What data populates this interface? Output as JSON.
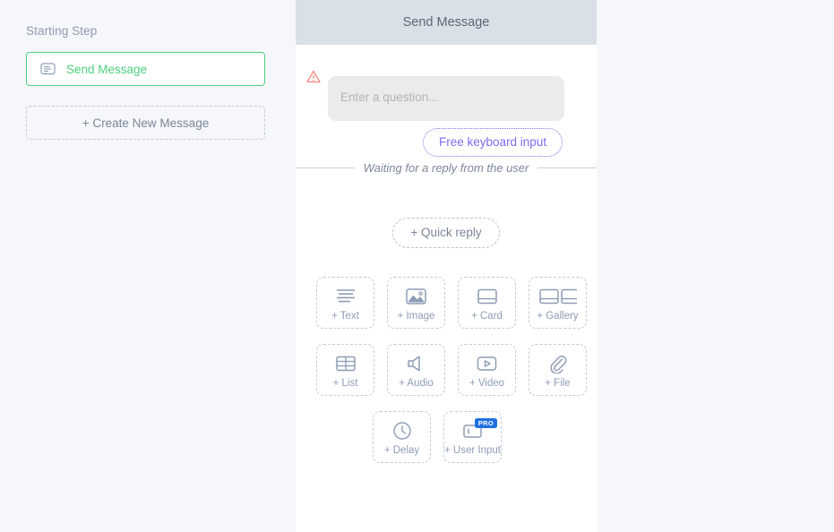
{
  "sidebar": {
    "section_label": "Starting Step",
    "steps": [
      {
        "label": "Send Message",
        "icon": "speech-bubble-icon",
        "color": "#4ed07e"
      }
    ],
    "create_button_label": "+ Create New Message"
  },
  "panel": {
    "title": "Send Message",
    "warning_icon": "warning-triangle-icon",
    "message": {
      "placeholder": "Enter a question...",
      "value": ""
    },
    "free_keyboard_input_label": "Free keyboard input",
    "waiting_text": "Waiting for a reply from the user",
    "quick_reply_label": "+ Quick reply",
    "tiles": [
      {
        "label": "+ Text",
        "icon": "text-lines-icon"
      },
      {
        "label": "+ Image",
        "icon": "image-icon"
      },
      {
        "label": "+ Card",
        "icon": "card-icon"
      },
      {
        "label": "+ Gallery",
        "icon": "gallery-icon"
      },
      {
        "label": "+ List",
        "icon": "list-table-icon"
      },
      {
        "label": "+ Audio",
        "icon": "speaker-icon"
      },
      {
        "label": "+ Video",
        "icon": "video-play-icon"
      },
      {
        "label": "+ File",
        "icon": "paperclip-icon"
      },
      {
        "label": "+ Delay",
        "icon": "clock-icon"
      },
      {
        "label": "+ User Input",
        "icon": "user-input-icon",
        "badge": "PRO"
      }
    ]
  },
  "colors": {
    "page_background": "#f5f7fa",
    "panel_header": "#d9e0e8",
    "accent_green": "#4ed07e",
    "accent_purple": "#7c6cf0",
    "warning_red": "#f5897e",
    "pro_badge_blue": "#1f6fe0",
    "icon_grey": "#8d9cb5"
  }
}
